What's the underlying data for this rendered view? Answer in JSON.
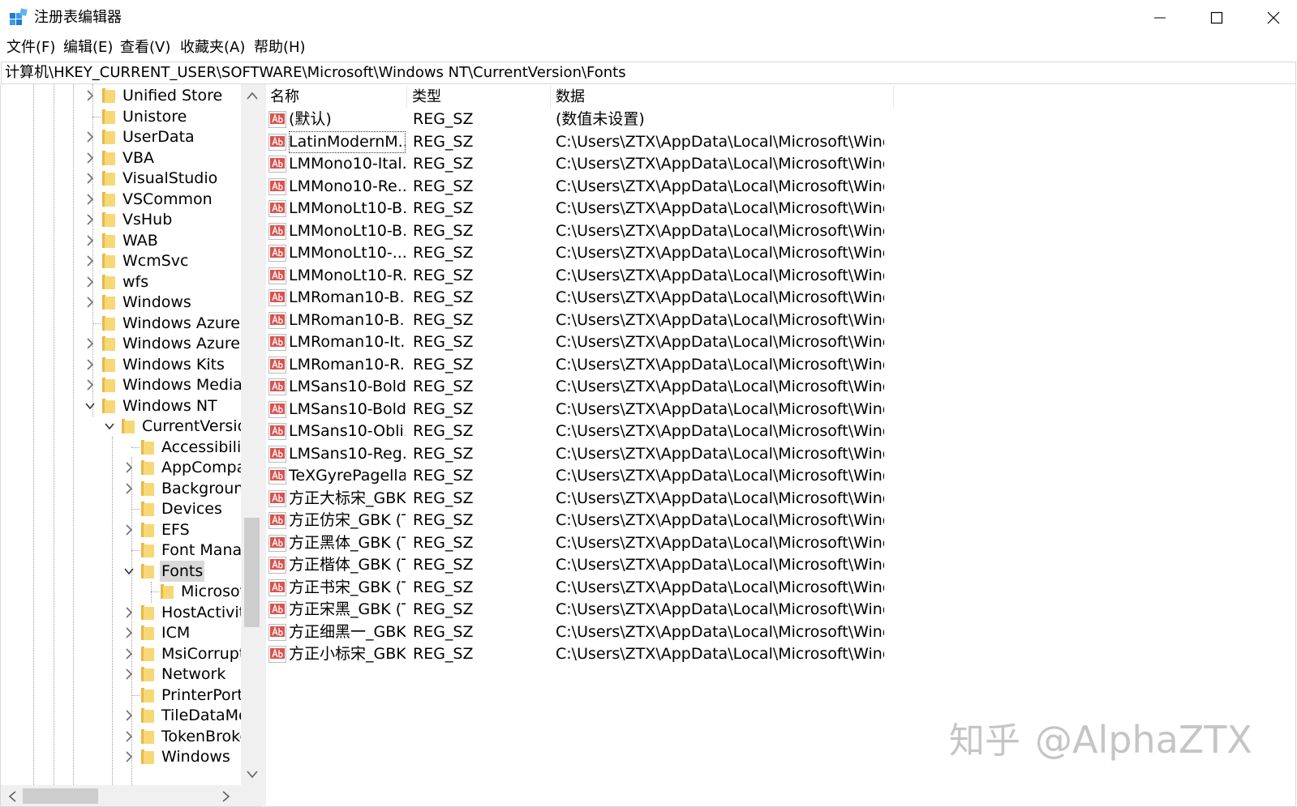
{
  "window": {
    "title": "注册表编辑器",
    "controls": {
      "minimize": "minimize-icon",
      "maximize": "maximize-icon",
      "close": "close-icon"
    }
  },
  "menu": [
    "文件(F)",
    "编辑(E)",
    "查看(V)",
    "收藏夹(A)",
    "帮助(H)"
  ],
  "address": "计算机\\HKEY_CURRENT_USER\\SOFTWARE\\Microsoft\\Windows NT\\CurrentVersion\\Fonts",
  "tree": {
    "items": [
      {
        "label": "Unified Store",
        "level": 0,
        "arrow": "collapsed"
      },
      {
        "label": "Unistore",
        "level": 0,
        "arrow": "none"
      },
      {
        "label": "UserData",
        "level": 0,
        "arrow": "collapsed"
      },
      {
        "label": "VBA",
        "level": 0,
        "arrow": "collapsed"
      },
      {
        "label": "VisualStudio",
        "level": 0,
        "arrow": "collapsed"
      },
      {
        "label": "VSCommon",
        "level": 0,
        "arrow": "collapsed"
      },
      {
        "label": "VsHub",
        "level": 0,
        "arrow": "collapsed"
      },
      {
        "label": "WAB",
        "level": 0,
        "arrow": "collapsed"
      },
      {
        "label": "WcmSvc",
        "level": 0,
        "arrow": "collapsed"
      },
      {
        "label": "wfs",
        "level": 0,
        "arrow": "collapsed"
      },
      {
        "label": "Windows",
        "level": 0,
        "arrow": "collapsed"
      },
      {
        "label": "Windows Azure I",
        "level": 0,
        "arrow": "none"
      },
      {
        "label": "Windows Azure S",
        "level": 0,
        "arrow": "collapsed"
      },
      {
        "label": "Windows Kits",
        "level": 0,
        "arrow": "collapsed"
      },
      {
        "label": "Windows Media",
        "level": 0,
        "arrow": "collapsed"
      },
      {
        "label": "Windows NT",
        "level": 0,
        "arrow": "expanded"
      },
      {
        "label": "CurrentVersion",
        "level": 1,
        "arrow": "expanded"
      },
      {
        "label": "Accessibility",
        "level": 2,
        "arrow": "none"
      },
      {
        "label": "AppCompatFlags",
        "level": 2,
        "arrow": "collapsed"
      },
      {
        "label": "BackgroundModel",
        "level": 2,
        "arrow": "collapsed"
      },
      {
        "label": "Devices",
        "level": 2,
        "arrow": "none"
      },
      {
        "label": "EFS",
        "level": 2,
        "arrow": "collapsed"
      },
      {
        "label": "Font Management",
        "level": 2,
        "arrow": "none"
      },
      {
        "label": "Fonts",
        "level": 2,
        "arrow": "expanded",
        "selected": true
      },
      {
        "label": "Microsoft",
        "level": 3,
        "arrow": "none"
      },
      {
        "label": "HostActivityManager",
        "level": 2,
        "arrow": "collapsed"
      },
      {
        "label": "ICM",
        "level": 2,
        "arrow": "collapsed"
      },
      {
        "label": "MsiCorruptedFileRecovery",
        "level": 2,
        "arrow": "collapsed"
      },
      {
        "label": "Network",
        "level": 2,
        "arrow": "collapsed"
      },
      {
        "label": "PrinterPorts",
        "level": 2,
        "arrow": "none"
      },
      {
        "label": "TileDataModel",
        "level": 2,
        "arrow": "collapsed"
      },
      {
        "label": "TokenBroker",
        "level": 2,
        "arrow": "collapsed"
      },
      {
        "label": "Windows",
        "level": 2,
        "arrow": "collapsed"
      }
    ]
  },
  "list": {
    "columns": [
      "名称",
      "类型",
      "数据"
    ],
    "rows": [
      {
        "name": "(默认)",
        "type": "REG_SZ",
        "data": "(数值未设置)"
      },
      {
        "name": "LatinModernM...",
        "type": "REG_SZ",
        "data": "C:\\Users\\ZTX\\AppData\\Local\\Microsoft\\Windo...",
        "focused": true
      },
      {
        "name": "LMMono10-Ital...",
        "type": "REG_SZ",
        "data": "C:\\Users\\ZTX\\AppData\\Local\\Microsoft\\Windo..."
      },
      {
        "name": "LMMono10-Re...",
        "type": "REG_SZ",
        "data": "C:\\Users\\ZTX\\AppData\\Local\\Microsoft\\Windo..."
      },
      {
        "name": "LMMonoLt10-B...",
        "type": "REG_SZ",
        "data": "C:\\Users\\ZTX\\AppData\\Local\\Microsoft\\Windo..."
      },
      {
        "name": "LMMonoLt10-B...",
        "type": "REG_SZ",
        "data": "C:\\Users\\ZTX\\AppData\\Local\\Microsoft\\Windo..."
      },
      {
        "name": "LMMonoLt10-...",
        "type": "REG_SZ",
        "data": "C:\\Users\\ZTX\\AppData\\Local\\Microsoft\\Windo..."
      },
      {
        "name": "LMMonoLt10-R...",
        "type": "REG_SZ",
        "data": "C:\\Users\\ZTX\\AppData\\Local\\Microsoft\\Windo..."
      },
      {
        "name": "LMRoman10-B...",
        "type": "REG_SZ",
        "data": "C:\\Users\\ZTX\\AppData\\Local\\Microsoft\\Windo..."
      },
      {
        "name": "LMRoman10-B...",
        "type": "REG_SZ",
        "data": "C:\\Users\\ZTX\\AppData\\Local\\Microsoft\\Windo..."
      },
      {
        "name": "LMRoman10-It...",
        "type": "REG_SZ",
        "data": "C:\\Users\\ZTX\\AppData\\Local\\Microsoft\\Windo..."
      },
      {
        "name": "LMRoman10-R...",
        "type": "REG_SZ",
        "data": "C:\\Users\\ZTX\\AppData\\Local\\Microsoft\\Windo..."
      },
      {
        "name": "LMSans10-Bold...",
        "type": "REG_SZ",
        "data": "C:\\Users\\ZTX\\AppData\\Local\\Microsoft\\Windo..."
      },
      {
        "name": "LMSans10-Bold...",
        "type": "REG_SZ",
        "data": "C:\\Users\\ZTX\\AppData\\Local\\Microsoft\\Windo..."
      },
      {
        "name": "LMSans10-Obli...",
        "type": "REG_SZ",
        "data": "C:\\Users\\ZTX\\AppData\\Local\\Microsoft\\Windo..."
      },
      {
        "name": "LMSans10-Reg...",
        "type": "REG_SZ",
        "data": "C:\\Users\\ZTX\\AppData\\Local\\Microsoft\\Windo..."
      },
      {
        "name": "TeXGyrePagella...",
        "type": "REG_SZ",
        "data": "C:\\Users\\ZTX\\AppData\\Local\\Microsoft\\Windo..."
      },
      {
        "name": "方正大标宋_GBK...",
        "type": "REG_SZ",
        "data": "C:\\Users\\ZTX\\AppData\\Local\\Microsoft\\Windo..."
      },
      {
        "name": "方正仿宋_GBK (T...",
        "type": "REG_SZ",
        "data": "C:\\Users\\ZTX\\AppData\\Local\\Microsoft\\Windo..."
      },
      {
        "name": "方正黑体_GBK (T...",
        "type": "REG_SZ",
        "data": "C:\\Users\\ZTX\\AppData\\Local\\Microsoft\\Windo..."
      },
      {
        "name": "方正楷体_GBK (T...",
        "type": "REG_SZ",
        "data": "C:\\Users\\ZTX\\AppData\\Local\\Microsoft\\Windo..."
      },
      {
        "name": "方正书宋_GBK (T...",
        "type": "REG_SZ",
        "data": "C:\\Users\\ZTX\\AppData\\Local\\Microsoft\\Windo..."
      },
      {
        "name": "方正宋黑_GBK (T...",
        "type": "REG_SZ",
        "data": "C:\\Users\\ZTX\\AppData\\Local\\Microsoft\\Windo..."
      },
      {
        "name": "方正细黑一_GBK...",
        "type": "REG_SZ",
        "data": "C:\\Users\\ZTX\\AppData\\Local\\Microsoft\\Windo..."
      },
      {
        "name": "方正小标宋_GBK...",
        "type": "REG_SZ",
        "data": "C:\\Users\\ZTX\\AppData\\Local\\Microsoft\\Windo..."
      }
    ]
  },
  "watermark": {
    "brand": "知乎",
    "handle": "@AlphaZTX"
  },
  "colors": {
    "folder": "#f8d775",
    "folder_dark": "#e8b84a",
    "ab_icon": "#d9534f",
    "selection": "#d9d9d9"
  }
}
